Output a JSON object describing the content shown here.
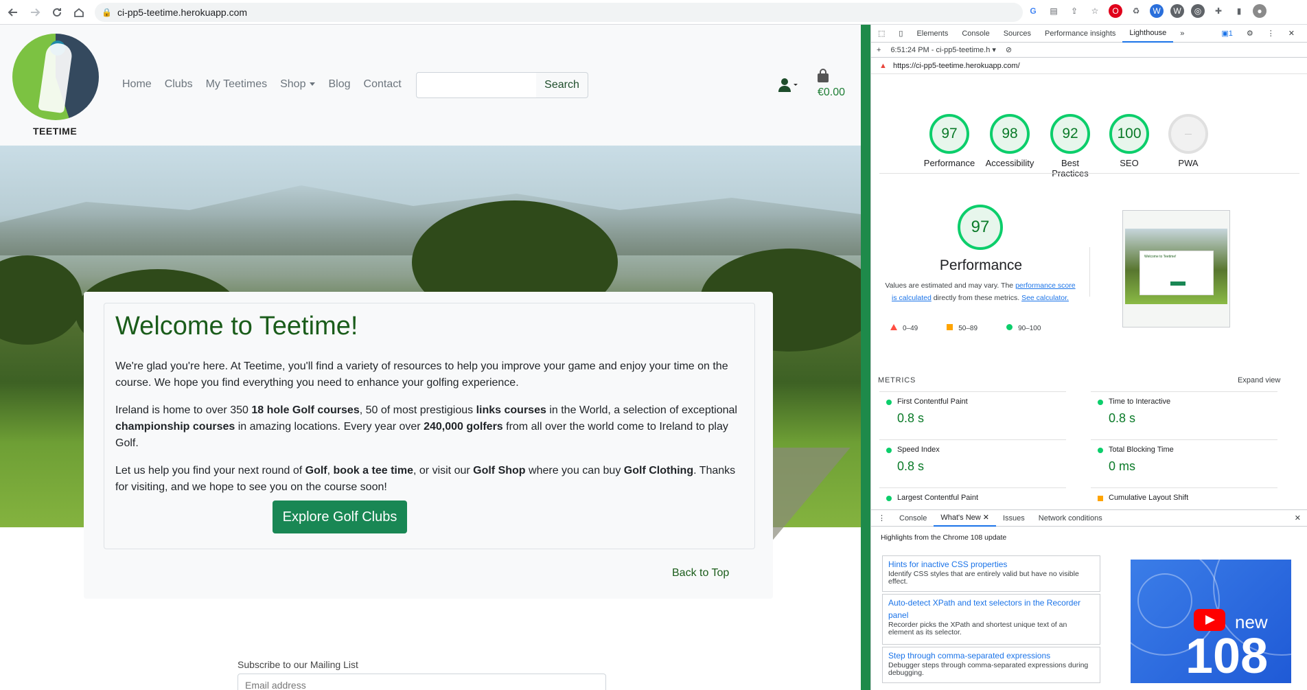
{
  "browser": {
    "url": "ci-pp5-teetime.herokuapp.com"
  },
  "site": {
    "logo_text": "TEETIME",
    "nav": [
      "Home",
      "Clubs",
      "My Teetimes",
      "Shop",
      "Blog",
      "Contact"
    ],
    "search_placeholder": "",
    "search_button": "Search",
    "cart_total": "€0.00",
    "welcome_title": "Welcome to Teetime!",
    "para1": "We're glad you're here. At Teetime, you'll find a variety of resources to help you improve your game and enjoy your time on the course. We hope you find everything you need to enhance your golfing experience.",
    "para2": {
      "t1": "Ireland is home to over 350 ",
      "b1": "18 hole Golf courses",
      "t2": ", 50 of most prestigious ",
      "b2": "links courses",
      "t3": " in the World, a selection of exceptional ",
      "b3": "championship courses",
      "t4": " in amazing locations. Every year over ",
      "b4": "240,000 golfers",
      "t5": " from all over the world come to Ireland to play Golf."
    },
    "para3": {
      "t1": "Let us help you find your next round of ",
      "b1": "Golf",
      "t2": ", ",
      "b2": "book a tee time",
      "t3": ", or visit our ",
      "b3": "Golf Shop",
      "t4": " where you can buy ",
      "b4": "Golf Clothing",
      "t5": ". Thanks for visiting, and we hope to see you on the course soon!"
    },
    "explore_button": "Explore Golf Clubs",
    "back_to_top": "Back to Top",
    "mailing_label": "Subscribe to our Mailing List",
    "mailing_placeholder": "Email address"
  },
  "devtools": {
    "tabs": [
      "Elements",
      "Console",
      "Sources",
      "Performance insights",
      "Lighthouse"
    ],
    "active_tab": "Lighthouse",
    "report_time": "6:51:24 PM - ci-pp5-teetime.h",
    "report_url": "https://ci-pp5-teetime.herokuapp.com/",
    "badge_count": "1",
    "scores": [
      {
        "label": "Performance",
        "value": "97"
      },
      {
        "label": "Accessibility",
        "value": "98"
      },
      {
        "label": "Best Practices",
        "value": "92"
      },
      {
        "label": "SEO",
        "value": "100"
      },
      {
        "label": "PWA",
        "value": "PWA"
      }
    ],
    "perf_score": "97",
    "perf_title": "Performance",
    "perf_desc_1": "Values are estimated and may vary. The ",
    "perf_link_1": "performance score is calculated",
    "perf_desc_2": " directly from these metrics. ",
    "perf_link_2": "See calculator.",
    "legend": [
      "0–49",
      "50–89",
      "90–100"
    ],
    "thumb_title": "Welcome to Teetime!",
    "metrics_heading": "METRICS",
    "expand_view": "Expand view",
    "metrics": [
      {
        "label": "First Contentful Paint",
        "value": "0.8 s",
        "status": "good"
      },
      {
        "label": "Time to Interactive",
        "value": "0.8 s",
        "status": "good"
      },
      {
        "label": "Speed Index",
        "value": "0.8 s",
        "status": "good"
      },
      {
        "label": "Total Blocking Time",
        "value": "0 ms",
        "status": "good"
      },
      {
        "label": "Largest Contentful Paint",
        "value": "",
        "status": "good"
      },
      {
        "label": "Cumulative Layout Shift",
        "value": "",
        "status": "average"
      }
    ],
    "drawer_tabs": [
      "Console",
      "What's New",
      "Issues",
      "Network conditions"
    ],
    "drawer_active": "What's New",
    "highlights": "Highlights from the Chrome 108 update",
    "news": [
      {
        "title": "Hints for inactive CSS properties",
        "desc": "Identify CSS styles that are entirely valid but have no visible effect."
      },
      {
        "title": "Auto-detect XPath and text selectors in the Recorder panel",
        "desc": "Recorder picks the XPath and shortest unique text of an element as its selector."
      },
      {
        "title": "Step through comma-separated expressions",
        "desc": "Debugger steps through comma-separated expressions during debugging."
      }
    ],
    "news_image_word": "new",
    "news_image_number": "108"
  },
  "colors": {
    "brand_green": "#198754",
    "title_green": "#1a5c1a",
    "lh_good": "#0cce6b",
    "lh_average": "#ffa400",
    "lh_poor": "#ff4e42",
    "devtools_blue": "#1a73e8"
  }
}
